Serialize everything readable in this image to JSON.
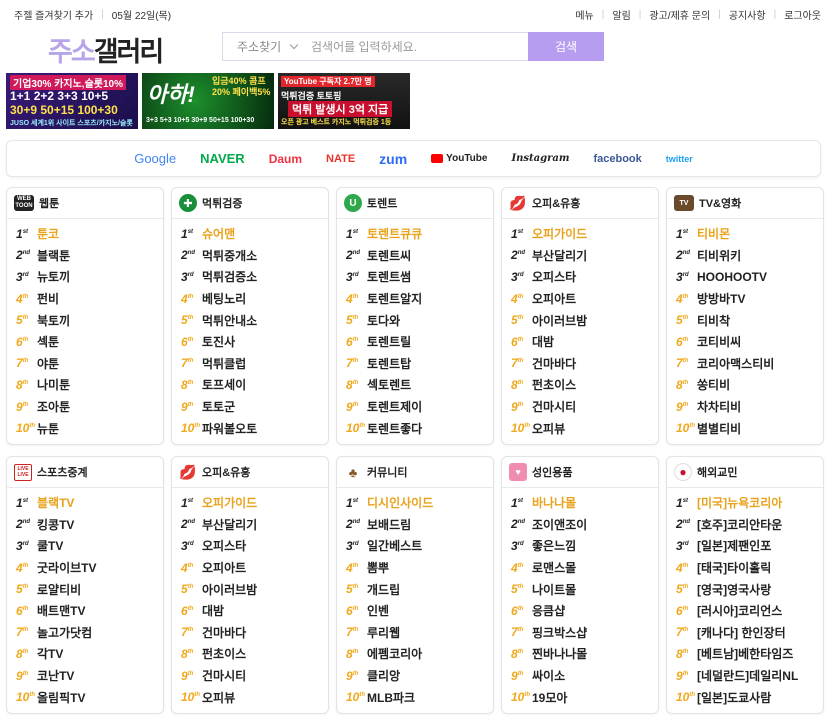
{
  "topbar": {
    "bookmark": "주젤 즐겨찾기 추가",
    "date": "05월 22일(목)",
    "links": [
      "메뉴",
      "알림",
      "광고/제휴 문의",
      "공지사항",
      "로그아웃"
    ]
  },
  "logo": {
    "part1": "주소",
    "part2": "갤러리"
  },
  "search": {
    "select_label": "주소찾기",
    "placeholder": "검색어를 입력하세요.",
    "button": "검색"
  },
  "banners": [
    {
      "l1": "기업30% 카지노,슬롯10%",
      "l2": "1+1 2+2 3+3 10+5",
      "l3": "30+9 50+15 100+30",
      "l4": "JUSO 세계1위 사이트 스포츠/카지노/슬롯"
    },
    {
      "l1": "아하!",
      "l2": "입금40% 콤프20% 페이백5%",
      "l3": "3+3 5+3 10+5 30+9 50+15 100+30"
    },
    {
      "l1": "YouTube 구독자 2.7만 명",
      "l2": "먹튀검증 토토핑",
      "l3": "먹튀 발생시 3억 지급",
      "l4": "오픈 광고 베스트 카지노 먹튀검증 1등"
    }
  ],
  "portals": [
    "Google",
    "NAVER",
    "Daum",
    "NATE",
    "zum",
    "YouTube",
    "Instagram",
    "facebook",
    "twitter"
  ],
  "colors": {
    "accent": "#b79df0",
    "first_rank": "#e8a21c"
  },
  "categories_row1": [
    {
      "title": "웹툰",
      "icon": "webtoon-icon",
      "items": [
        "툰코",
        "블랙툰",
        "뉴토끼",
        "펀비",
        "북토끼",
        "섹툰",
        "야툰",
        "나미툰",
        "조아툰",
        "뉴툰"
      ]
    },
    {
      "title": "먹튀검증",
      "icon": "check-icon",
      "items": [
        "슈어맨",
        "먹튀중개소",
        "먹튀검증소",
        "베팅노리",
        "먹튀안내소",
        "토진사",
        "먹튀클럽",
        "토프세이",
        "토토군",
        "파워볼오토"
      ]
    },
    {
      "title": "토렌트",
      "icon": "torrent-icon",
      "items": [
        "토렌트큐큐",
        "토렌트씨",
        "토렌트썸",
        "토렌트알지",
        "토다와",
        "토렌트릴",
        "토렌트탑",
        "섹토렌트",
        "토렌트제이",
        "토렌트좋다"
      ]
    },
    {
      "title": "오피&유흥",
      "icon": "lips-icon",
      "items": [
        "오피가이드",
        "부산달리기",
        "오피스타",
        "오피아트",
        "아이러브밤",
        "대밤",
        "건마바다",
        "펀초이스",
        "건마시티",
        "오피뷰"
      ]
    },
    {
      "title": "TV&영화",
      "icon": "tv-icon",
      "items": [
        "티비몬",
        "티비위키",
        "HOOHOOTV",
        "방방바TV",
        "티비착",
        "코티비씨",
        "코리아맥스티비",
        "쏭티비",
        "차차티비",
        "별별티비"
      ]
    }
  ],
  "categories_row2": [
    {
      "title": "스포츠중계",
      "icon": "live-icon",
      "items": [
        "블랙TV",
        "킹콩TV",
        "쿨TV",
        "굿라이브TV",
        "로얄티비",
        "배트맨TV",
        "놀고가닷컴",
        "각TV",
        "코난TV",
        "올림픽TV"
      ]
    },
    {
      "title": "오피&유흥",
      "icon": "lips-icon",
      "items": [
        "오피가이드",
        "부산달리기",
        "오피스타",
        "오피아트",
        "아이러브밤",
        "대밤",
        "건마바다",
        "펀초이스",
        "건마시티",
        "오피뷰"
      ]
    },
    {
      "title": "커뮤니티",
      "icon": "community-icon",
      "items": [
        "디시인사이드",
        "보배드림",
        "일간베스트",
        "뽐뿌",
        "개드립",
        "인벤",
        "루리웹",
        "에펨코리아",
        "클리앙",
        "MLB파크"
      ]
    },
    {
      "title": "성인용품",
      "icon": "adult-icon",
      "items": [
        "바나나몰",
        "조이앤조이",
        "좋은느낌",
        "로맨스몰",
        "나이트몰",
        "응큼샵",
        "핑크박스샵",
        "찐바나나몰",
        "싸이소",
        "19모아"
      ]
    },
    {
      "title": "해외교민",
      "icon": "overseas-icon",
      "items": [
        "[미국]뉴욕코리아",
        "[호주]코리안타운",
        "[일본]제팬인포",
        "[태국]타이홀릭",
        "[영국]영국사랑",
        "[러시아]코리언스",
        "[캐나다] 한인장터",
        "[베트남]베한타임즈",
        "[네덜란드]데일리NL",
        "[일본]도쿄사람"
      ]
    }
  ]
}
